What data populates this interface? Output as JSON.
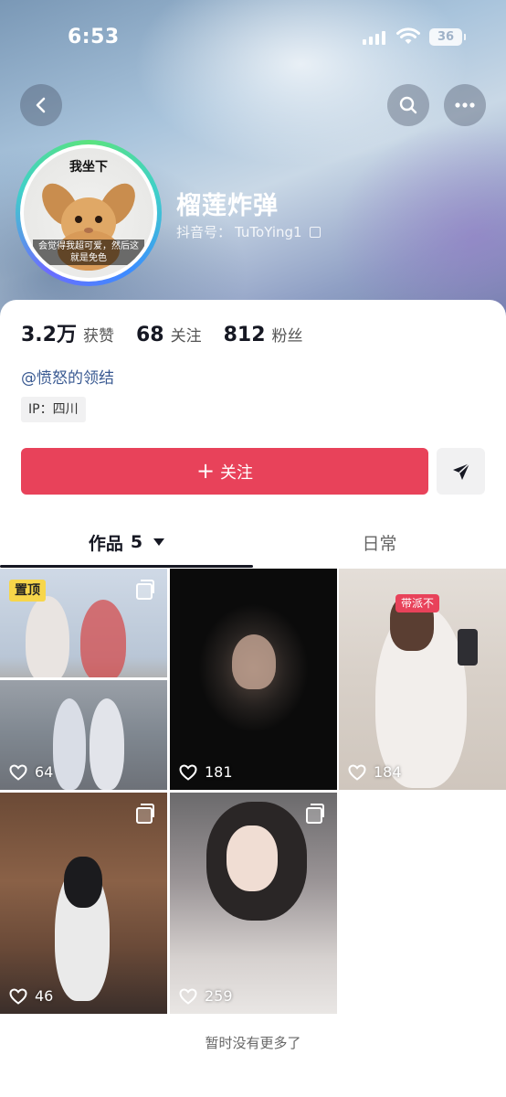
{
  "status_bar": {
    "time": "6:53",
    "battery": "36"
  },
  "header": {
    "back_icon": "chevron-left-icon",
    "search_icon": "search-icon",
    "more_icon": "more-horizontal-icon"
  },
  "profile": {
    "avatar_caption_top": "我坐下",
    "avatar_caption_bottom": "会觉得我超可爱，然后这就是免色",
    "display_name": "榴莲炸弹",
    "douyin_id_label": "抖音号：",
    "douyin_id": "TuToYing1",
    "copy_icon": "copy-icon"
  },
  "stats": [
    {
      "value": "3.2万",
      "label": "获赞"
    },
    {
      "value": "68",
      "label": "关注"
    },
    {
      "value": "812",
      "label": "粉丝"
    }
  ],
  "bio": {
    "mention": "@愤怒的领结",
    "ip": "IP：四川"
  },
  "actions": {
    "follow_plus": "+",
    "follow_label": "关注",
    "share_icon": "send-icon"
  },
  "tabs": {
    "works_label": "作品",
    "works_count": "5",
    "daily_label": "日常"
  },
  "grid": {
    "items": [
      {
        "pinned_label": "置顶",
        "likes": "64",
        "multi": true
      },
      {
        "likes": "181",
        "multi": false
      },
      {
        "likes": "184",
        "multi": false,
        "sticker": "带派不"
      },
      {
        "likes": "46",
        "multi": true
      },
      {
        "likes": "259",
        "multi": true
      }
    ]
  },
  "footer": {
    "no_more": "暂时没有更多了"
  },
  "colors": {
    "accent": "#e8425a",
    "pin_badge": "#f7d64a",
    "mention": "#3a5a92"
  }
}
